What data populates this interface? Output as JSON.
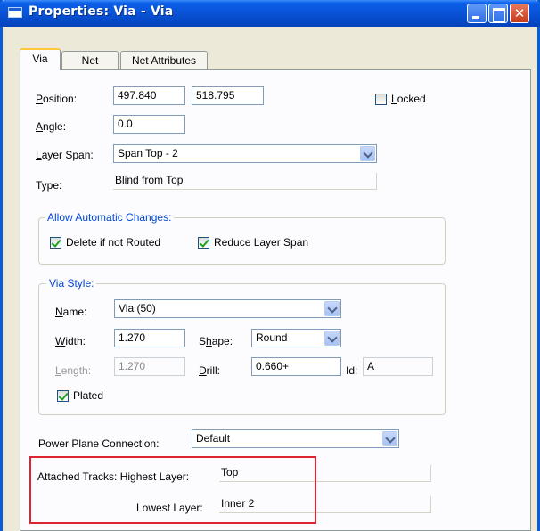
{
  "window": {
    "title": "Properties: Via - Via"
  },
  "tabs": [
    {
      "label": "Via",
      "active": true
    },
    {
      "label": "Net",
      "active": false
    },
    {
      "label": "Net Attributes",
      "active": false
    }
  ],
  "position": {
    "label_u": "P",
    "label_rest": "osition:",
    "x": "497.840",
    "y": "518.795"
  },
  "locked": {
    "label_u": "L",
    "label_rest": "ocked",
    "checked": false
  },
  "angle": {
    "label_u": "A",
    "label_rest": "ngle:",
    "value": "0.0"
  },
  "layer_span": {
    "label_u": "L",
    "label_rest": "ayer Span:",
    "value": "Span Top - 2"
  },
  "type": {
    "label": "Type:",
    "value": "Blind from Top"
  },
  "auto_changes": {
    "title": "Allow Automatic Changes:",
    "delete_label": "Delete if not Routed",
    "delete_checked": true,
    "reduce_label": "Reduce Layer Span",
    "reduce_checked": true
  },
  "via_style": {
    "title": "Via Style:",
    "name_label_u": "N",
    "name_label_rest": "ame:",
    "name_value": "Via (50)",
    "width_label_u": "W",
    "width_label_rest": "idth:",
    "width_value": "1.270",
    "shape_label_pre": "S",
    "shape_label_u": "h",
    "shape_label_rest": "ape:",
    "shape_value": "Round",
    "length_label_u": "L",
    "length_label_rest": "ength:",
    "length_value": "1.270",
    "drill_label_u": "D",
    "drill_label_rest": "rill:",
    "drill_value": "0.660+",
    "id_label": "Id:",
    "id_value": "A",
    "plated_label": "Plated",
    "plated_checked": true
  },
  "power_plane": {
    "label": "Power Plane Connection:",
    "value": "Default"
  },
  "attached_tracks": {
    "highest_label": "Attached Tracks: Highest Layer:",
    "highest_value": "Top",
    "lowest_label": "Lowest Layer:",
    "lowest_value": "Inner 2"
  },
  "colors": {
    "title_bar": "#0a52d6",
    "group_title": "#0046d5",
    "highlight_box": "#e0242f"
  }
}
